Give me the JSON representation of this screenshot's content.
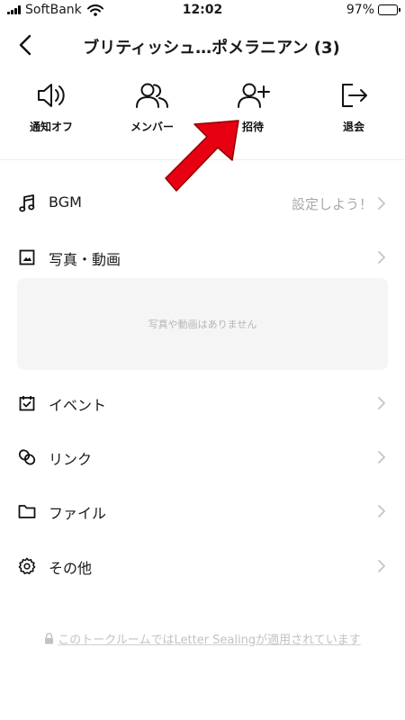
{
  "status_bar": {
    "carrier": "SoftBank",
    "time": "12:02",
    "battery_percent": "97%",
    "battery_level": 0.97
  },
  "header": {
    "title": "ブリティッシュ…ポメラニアン (3)"
  },
  "actions": [
    {
      "label": "通知オフ",
      "icon": "speaker-icon"
    },
    {
      "label": "メンバー",
      "icon": "members-icon"
    },
    {
      "label": "招待",
      "icon": "add-friend-icon"
    },
    {
      "label": "退会",
      "icon": "leave-icon"
    }
  ],
  "menu": {
    "bgm": {
      "label": "BGM",
      "value": "設定しよう！",
      "icon": "music-note-icon"
    },
    "photos": {
      "label": "写真・動画",
      "icon": "photo-icon",
      "empty_text": "写真や動画はありません"
    },
    "events": {
      "label": "イベント",
      "icon": "calendar-icon"
    },
    "links": {
      "label": "リンク",
      "icon": "link-icon"
    },
    "files": {
      "label": "ファイル",
      "icon": "folder-icon"
    },
    "other": {
      "label": "その他",
      "icon": "gear-icon"
    }
  },
  "footer": {
    "text": "このトークルームではLetter Sealingが適用されています",
    "icon": "lock-icon"
  },
  "colors": {
    "battery": "#4cd964",
    "pointer_arrow": "#e60012",
    "muted_text": "#a8a8a8",
    "media_box_bg": "#f5f5f5"
  }
}
